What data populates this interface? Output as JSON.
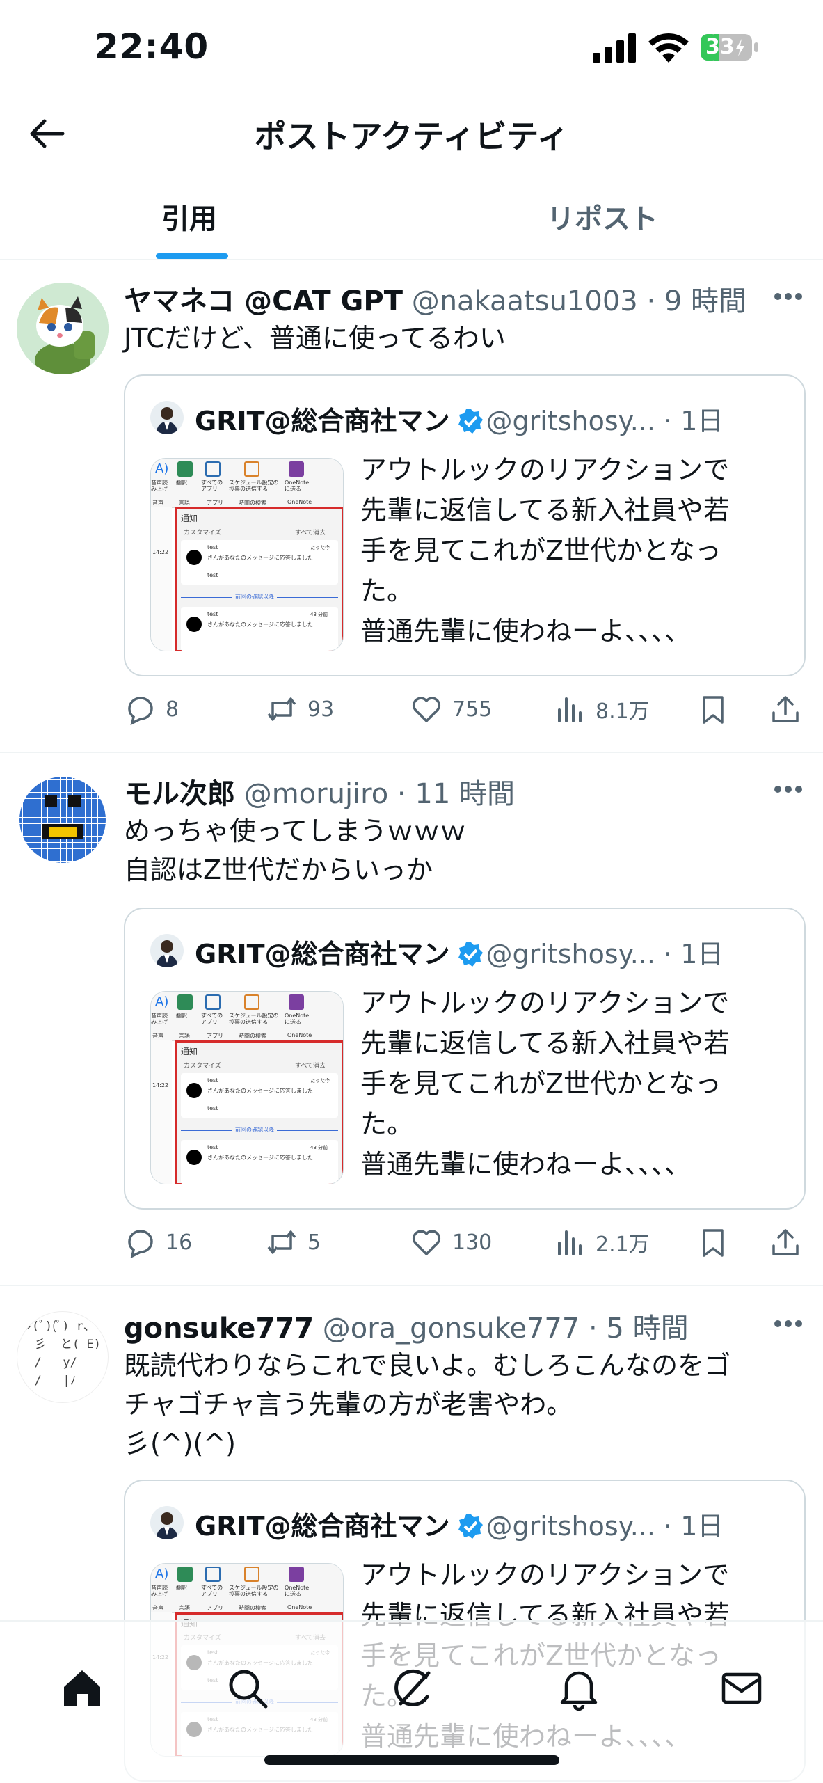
{
  "status_bar": {
    "time": "22:40",
    "battery": "33"
  },
  "header": {
    "title": "ポストアクティビティ"
  },
  "tabs": [
    {
      "label": "引用",
      "active": true
    },
    {
      "label": "リポスト",
      "active": false
    }
  ],
  "colors": {
    "accent": "#1d9bf0",
    "text": "#0f1419",
    "secondary": "#536471",
    "border": "#cfd9de"
  },
  "quoted": {
    "name": "GRIT@総合商社マン",
    "handle_time": "@gritshosy... · 1日",
    "lines": [
      "アウトルックのリアクションで",
      "先輩に返信してる新入社員や若",
      "手を見てこれがZ世代かとなっ",
      "た。",
      "普通先輩に使わねーよ、、、、"
    ]
  },
  "thumb": {
    "ribbon": [
      "音声読み上げ",
      "翻訳",
      "すべてのアプリ",
      "スケジュール設定の投票の送信する",
      "OneNoteに送る"
    ],
    "ribbon_groups": [
      "音声",
      "言語",
      "アプリ",
      "時間の検索",
      "OneNote"
    ],
    "panel_title": "通知",
    "customize": "カスタマイズ",
    "mark_all": "すべて消去",
    "item_name": "test",
    "item_text": "さんがあなたのメッセージに応答しました",
    "item_sub": "test",
    "item_time1": "たった今",
    "section": "前回の確認以降",
    "item_time2": "43 分前",
    "left_time": "14:22"
  },
  "posts": [
    {
      "name": "ヤマネコ @CAT GPT",
      "handle_time": "@nakaatsu1003 · 9 時間",
      "lines": [
        "JTCだけど、普通に使ってるわい"
      ],
      "stats": {
        "replies": "8",
        "reposts": "93",
        "likes": "755",
        "views": "8.1万"
      }
    },
    {
      "name": "モル次郎",
      "handle_time": "@morujiro · 11 時間",
      "lines": [
        "めっちゃ使ってしまうｗｗｗ",
        "自認はZ世代だからいっか"
      ],
      "stats": {
        "replies": "16",
        "reposts": "5",
        "likes": "130",
        "views": "2.1万"
      }
    },
    {
      "name": "gonsuke777",
      "handle_time": "@ora_gonsuke777 · 5 時間",
      "lines": [
        "既読代わりならこれで良いよ。むしろこんなのをゴ",
        "チャゴチャ言う先輩の方が老害やわ。",
        "彡(^)(^)"
      ],
      "avatar_art": [
        "彡(ﾟ)(ﾟ) r、",
        "  彡  と( E)",
        "  /   y/",
        "  /   |ﾉ"
      ]
    }
  ]
}
